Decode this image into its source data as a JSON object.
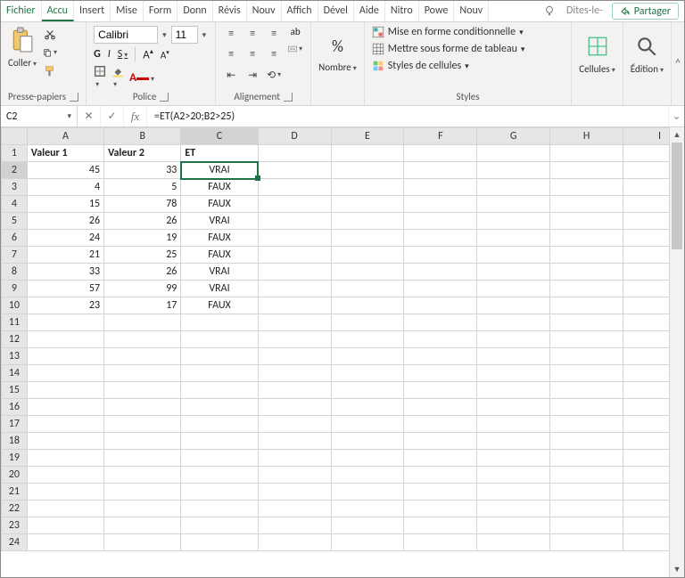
{
  "tabs": {
    "file": "Fichier",
    "home": "Accu",
    "others": [
      "Insert",
      "Mise",
      "Form",
      "Donn",
      "Révis",
      "Nouv",
      "Affich",
      "Dével",
      "Aide",
      "Nitro",
      "Powe",
      "Nouv"
    ],
    "tell": "Dites-le-",
    "share": "Partager"
  },
  "ribbon": {
    "clipboard": {
      "paste": "Coller",
      "label": "Presse-papiers"
    },
    "font": {
      "name": "Calibri",
      "size": "11",
      "bold": "G",
      "italic": "I",
      "underline": "S",
      "label": "Police"
    },
    "align": {
      "wrap": "ab",
      "label": "Alignement"
    },
    "number": {
      "percent": "%",
      "label": "Nombre"
    },
    "styles": {
      "cond": "Mise en forme conditionnelle",
      "table": "Mettre sous forme de tableau",
      "cell": "Styles de cellules",
      "label": "Styles"
    },
    "cells": {
      "label": "Cellules"
    },
    "editing": {
      "label": "Édition"
    }
  },
  "formula_bar": {
    "cell_ref": "C2",
    "formula": "=ET(A2>20;B2>25)"
  },
  "columns": [
    "A",
    "B",
    "C",
    "D",
    "E",
    "F",
    "G",
    "H",
    "I"
  ],
  "headers": {
    "A": "Valeur 1",
    "B": "Valeur 2",
    "C": "ET"
  },
  "rows": [
    {
      "n": 2,
      "a": 45,
      "b": 33,
      "c": "VRAI"
    },
    {
      "n": 3,
      "a": 4,
      "b": 5,
      "c": "FAUX"
    },
    {
      "n": 4,
      "a": 15,
      "b": 78,
      "c": "FAUX"
    },
    {
      "n": 5,
      "a": 26,
      "b": 26,
      "c": "VRAI"
    },
    {
      "n": 6,
      "a": 24,
      "b": 19,
      "c": "FAUX"
    },
    {
      "n": 7,
      "a": 21,
      "b": 25,
      "c": "FAUX"
    },
    {
      "n": 8,
      "a": 33,
      "b": 26,
      "c": "VRAI"
    },
    {
      "n": 9,
      "a": 57,
      "b": 99,
      "c": "VRAI"
    },
    {
      "n": 10,
      "a": 23,
      "b": 17,
      "c": "FAUX"
    }
  ],
  "selected_cell": "C2",
  "total_visible_rows": 24
}
